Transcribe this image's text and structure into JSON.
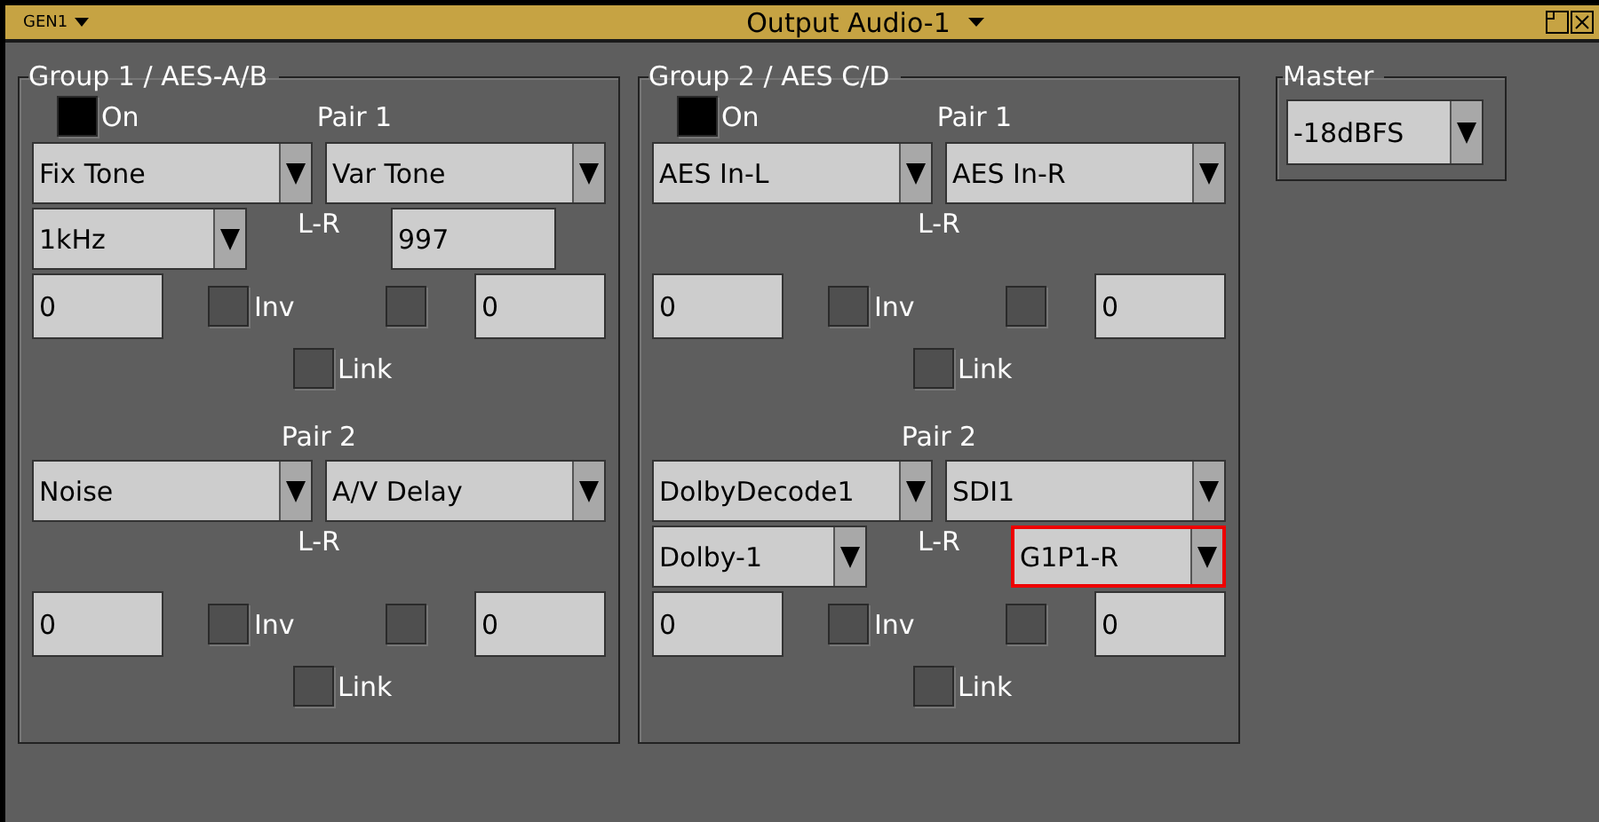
{
  "title_bar": {
    "menu_label": "GEN1",
    "title": "Output Audio-1"
  },
  "groups": [
    {
      "title": "Group 1 / AES-A/B",
      "on": {
        "label": "On",
        "checked": true
      },
      "pairs": [
        {
          "label": "Pair 1",
          "sources": [
            {
              "value": "Fix Tone",
              "focused": false
            },
            {
              "value": "Var Tone",
              "focused": false
            }
          ],
          "routing_label": "L-R",
          "sub_left": {
            "kind": "dropdown",
            "value": "1kHz",
            "focused": false
          },
          "sub_right": {
            "kind": "field",
            "value": "997"
          },
          "left_field": "0",
          "right_field": "0",
          "invert": {
            "label": "Inv",
            "checked": false
          },
          "right_checked": false,
          "link": {
            "label": "Link",
            "checked": false
          }
        },
        {
          "label": "Pair 2",
          "sources": [
            {
              "value": "Noise",
              "focused": false
            },
            {
              "value": "A/V Delay",
              "focused": false
            }
          ],
          "routing_label": "L-R",
          "left_field": "0",
          "right_field": "0",
          "invert": {
            "label": "Inv",
            "checked": false
          },
          "right_checked": false,
          "link": {
            "label": "Link",
            "checked": false
          }
        }
      ]
    },
    {
      "title": "Group 2 / AES C/D",
      "on": {
        "label": "On",
        "checked": true
      },
      "pairs": [
        {
          "label": "Pair 1",
          "sources": [
            {
              "value": "AES In-L",
              "focused": false
            },
            {
              "value": "AES In-R",
              "focused": false
            }
          ],
          "routing_label": "L-R",
          "left_field": "0",
          "right_field": "0",
          "invert": {
            "label": "Inv",
            "checked": false
          },
          "right_checked": false,
          "link": {
            "label": "Link",
            "checked": false
          }
        },
        {
          "label": "Pair 2",
          "sources": [
            {
              "value": "DolbyDecode1",
              "focused": false
            },
            {
              "value": "SDI1",
              "focused": false
            }
          ],
          "routing_label": "L-R",
          "sub_left": {
            "kind": "dropdown",
            "value": "Dolby-1",
            "focused": false
          },
          "sub_right": {
            "kind": "dropdown",
            "value": "G1P1-R",
            "focused": true
          },
          "left_field": "0",
          "right_field": "0",
          "invert": {
            "label": "Inv",
            "checked": false
          },
          "right_checked": false,
          "link": {
            "label": "Link",
            "checked": false
          }
        }
      ]
    }
  ],
  "master": {
    "title": "Master",
    "value": "-18dBFS"
  }
}
